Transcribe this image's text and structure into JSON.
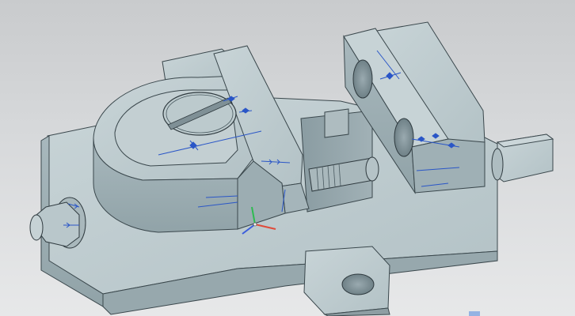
{
  "viewport": {
    "kind": "3d-cad-model-view",
    "background_top": "#c9cbcd",
    "background_bottom": "#e7e8e9",
    "model_color": "#b9c7cb",
    "model_shadow_color": "#8e9ea3",
    "edge_color": "#2f3a3f",
    "annotation_color": "#2a56c7"
  },
  "model": {
    "name": "machine-vise-assembly",
    "components": [
      "base",
      "movable-jaw",
      "fixed-jaw",
      "lead-screw",
      "hex-nut",
      "mounting-lug",
      "slotted-screw-head",
      "shaft-end"
    ]
  },
  "triad": {
    "x_color": "#e04b3a",
    "y_color": "#2dbb50",
    "z_color": "#3a5ddc"
  }
}
